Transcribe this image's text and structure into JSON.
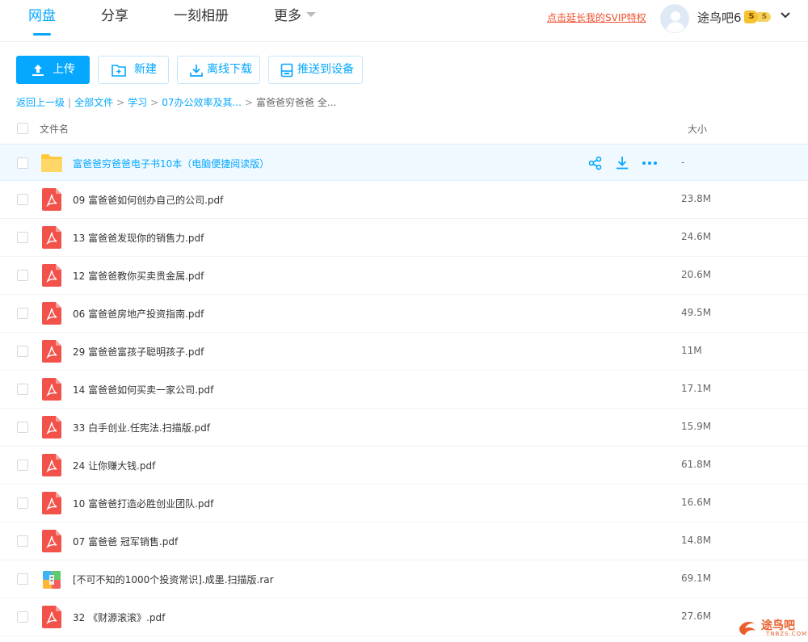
{
  "nav": {
    "tabs": [
      {
        "label": "网盘"
      },
      {
        "label": "分享"
      },
      {
        "label": "一刻相册"
      },
      {
        "label": "更多"
      }
    ],
    "svip_link": "点击延长我的SVIP特权",
    "username": "途鸟吧6",
    "badge1": "S",
    "badge2": "S"
  },
  "toolbar": {
    "upload": "上传",
    "new": "新建",
    "offline": "离线下载",
    "push": "推送到设备"
  },
  "breadcrumb": {
    "back": "返回上一级",
    "all": "全部文件",
    "c1": "学习",
    "c2": "07办公效率及其...",
    "current": "富爸爸穷爸爸 全..."
  },
  "table": {
    "header_name": "文件名",
    "header_size": "大小",
    "rows": [
      {
        "name": "富爸爸穷爸爸电子书10本（电脑便捷阅读版）",
        "size": "-",
        "type": "folder"
      },
      {
        "name": "09 富爸爸如何创办自己的公司.pdf",
        "size": "23.8M",
        "type": "pdf"
      },
      {
        "name": "13 富爸爸发现你的销售力.pdf",
        "size": "24.6M",
        "type": "pdf"
      },
      {
        "name": "12 富爸爸教你买卖贵金属.pdf",
        "size": "20.6M",
        "type": "pdf"
      },
      {
        "name": "06 富爸爸房地产投资指南.pdf",
        "size": "49.5M",
        "type": "pdf"
      },
      {
        "name": "29 富爸爸富孩子聪明孩子.pdf",
        "size": "11M",
        "type": "pdf"
      },
      {
        "name": "14 富爸爸如何买卖一家公司.pdf",
        "size": "17.1M",
        "type": "pdf"
      },
      {
        "name": "33 白手创业.任宪法.扫描版.pdf",
        "size": "15.9M",
        "type": "pdf"
      },
      {
        "name": "24 让你赚大钱.pdf",
        "size": "61.8M",
        "type": "pdf"
      },
      {
        "name": "10 富爸爸打造必胜创业团队.pdf",
        "size": "16.6M",
        "type": "pdf"
      },
      {
        "name": "07 富爸爸 冠军销售.pdf",
        "size": "14.8M",
        "type": "pdf"
      },
      {
        "name": "[不可不知的1000个投资常识].成墨.扫描版.rar",
        "size": "69.1M",
        "type": "rar"
      },
      {
        "name": "32 《财源滚滚》.pdf",
        "size": "27.6M",
        "type": "pdf"
      }
    ]
  },
  "watermark": {
    "title": "途鸟吧",
    "sub": "TNBZS.COM"
  },
  "colors": {
    "accent": "#06a7ff",
    "pdf": "#f2524a",
    "folder": "#ffc83d",
    "svip": "#f04f2e"
  }
}
